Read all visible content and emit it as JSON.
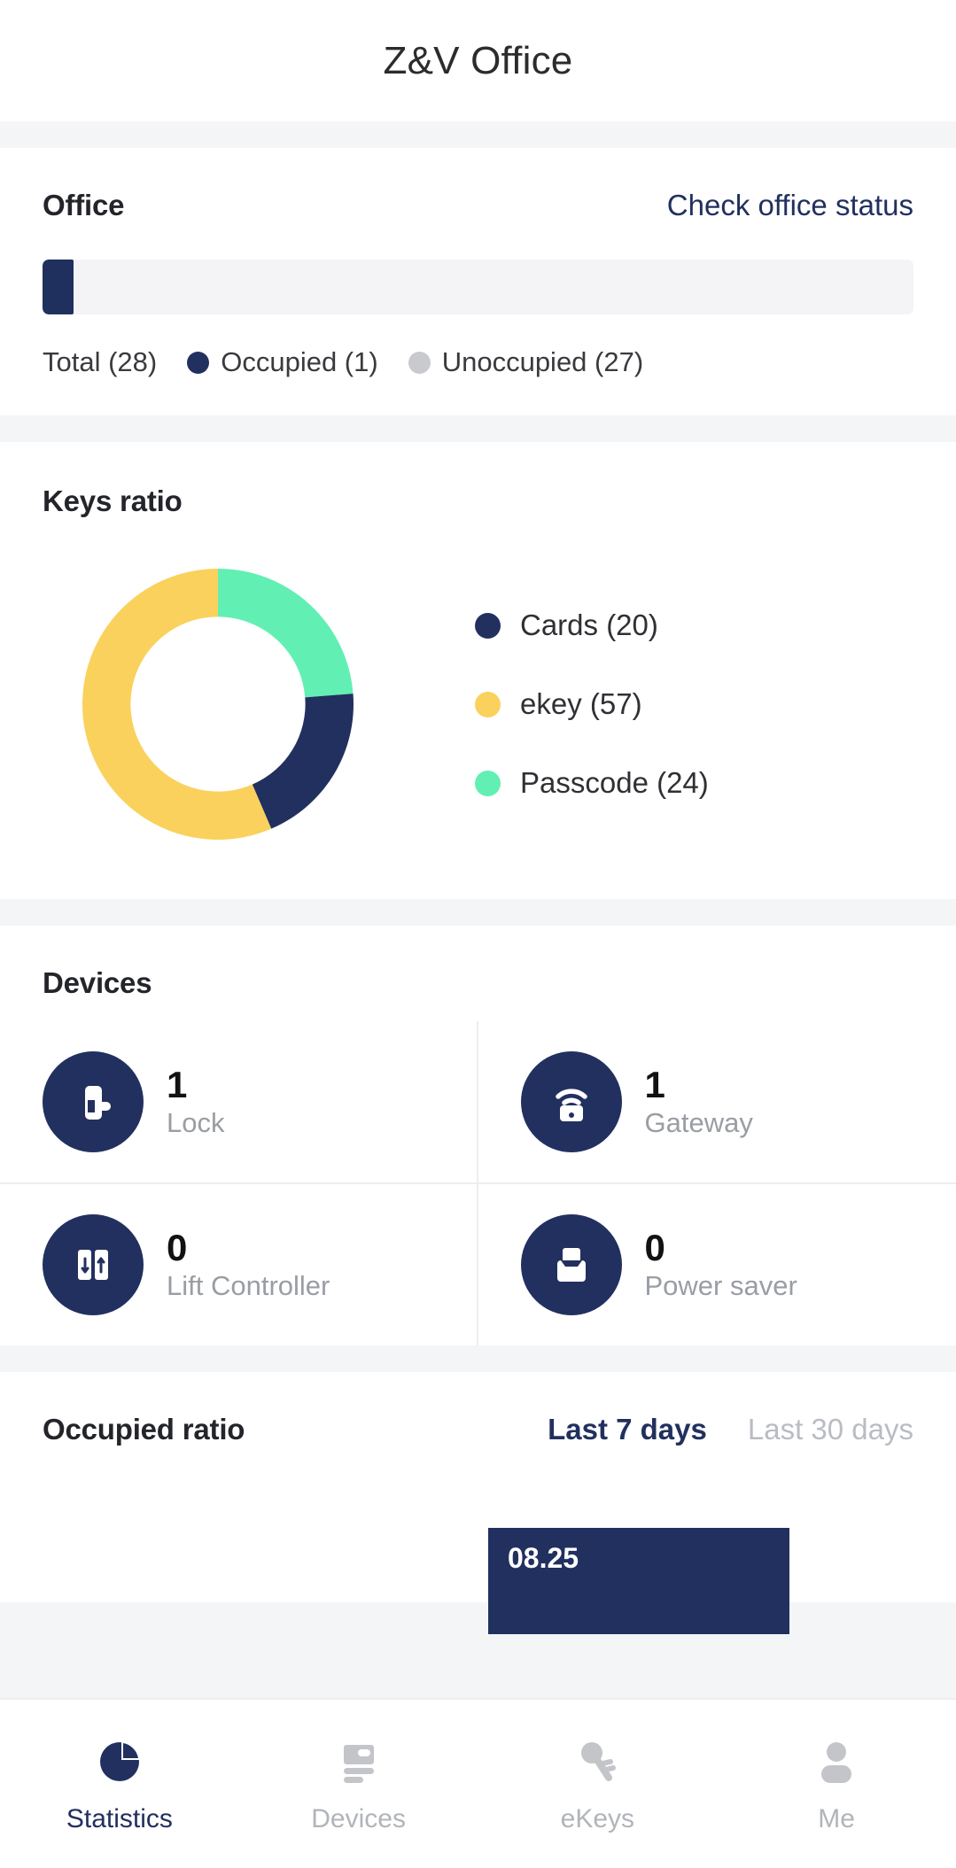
{
  "header": {
    "title": "Z&V Office"
  },
  "colors": {
    "navy": "#22305f",
    "yellow": "#fad15c",
    "mint": "#62efb4",
    "grey": "#c8cacd",
    "track": "#f4f4f6"
  },
  "office": {
    "title": "Office",
    "link_label": "Check office status",
    "bar": {
      "fill_percent": 3.6
    },
    "legend": [
      {
        "label": "Total (28)",
        "has_dot": false,
        "color": ""
      },
      {
        "label": "Occupied (1)",
        "has_dot": true,
        "color": "#22305f"
      },
      {
        "label": "Unoccupied (27)",
        "has_dot": true,
        "color": "#c8cacd"
      }
    ],
    "total": 28,
    "occupied": 1,
    "unoccupied": 27
  },
  "keys_ratio": {
    "title": "Keys ratio",
    "legend": [
      {
        "label": "Cards (20)",
        "color": "#22305f",
        "value": 20
      },
      {
        "label": "ekey (57)",
        "color": "#fad15c",
        "value": 57
      },
      {
        "label": "Passcode (24)",
        "color": "#62efb4",
        "value": 24
      }
    ]
  },
  "devices": {
    "title": "Devices",
    "items": [
      {
        "count": "1",
        "label": "Lock",
        "icon": "door-lock-icon"
      },
      {
        "count": "1",
        "label": "Gateway",
        "icon": "gateway-wifi-icon"
      },
      {
        "count": "0",
        "label": "Lift Controller",
        "icon": "lift-doors-icon"
      },
      {
        "count": "0",
        "label": "Power saver",
        "icon": "card-slot-icon"
      }
    ]
  },
  "occupied_ratio": {
    "title": "Occupied ratio",
    "tab_active": "Last 7 days",
    "tab_idle": "Last 30 days",
    "tooltip_label": "08.25"
  },
  "nav": {
    "items": [
      {
        "label": "Statistics",
        "icon": "pie-chart-icon",
        "active": true
      },
      {
        "label": "Devices",
        "icon": "device-card-icon",
        "active": false
      },
      {
        "label": "eKeys",
        "icon": "key-icon",
        "active": false
      },
      {
        "label": "Me",
        "icon": "person-icon",
        "active": false
      }
    ]
  },
  "chart_data": {
    "type": "pie",
    "title": "Keys ratio",
    "labels": [
      "Cards",
      "ekey",
      "Passcode"
    ],
    "values": [
      20,
      57,
      24
    ],
    "colors": [
      "#22305f",
      "#fad15c",
      "#62efb4"
    ],
    "total": 101,
    "donut": true,
    "legend_position": "right",
    "start_angle_deg": 0,
    "direction": "clockwise",
    "slice_order": [
      "Passcode",
      "Cards",
      "ekey"
    ]
  }
}
